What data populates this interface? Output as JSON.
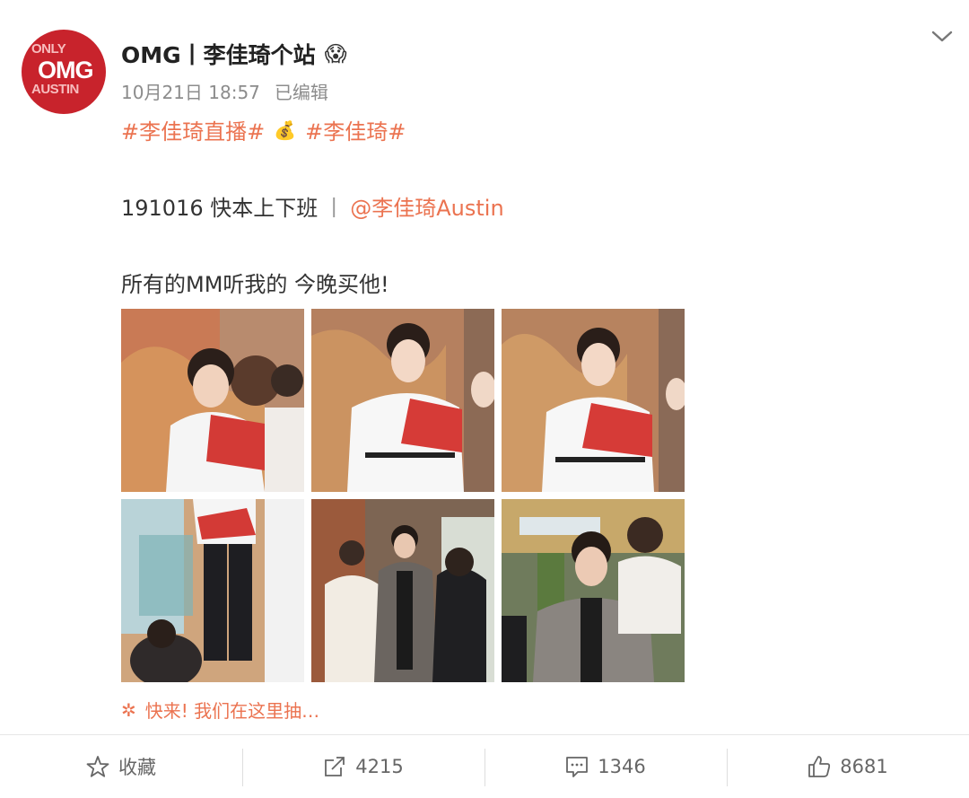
{
  "post": {
    "avatar_text": {
      "top": "ONLY",
      "middle": "OMG",
      "bottom": "AUSTIN"
    },
    "author": "OMG丨李佳琦个站",
    "author_emoji": "😱",
    "time": "10月21日 18:57",
    "edited": "已编辑",
    "tags": [
      "#李佳琦直播#",
      "💰",
      "#李佳琦#"
    ],
    "line1_text": "191016 快本上下班",
    "line1_sep": "丨",
    "mention": "@李佳琦Austin",
    "line2_text": "所有的MM听我的 今晚买他!",
    "photos": [
      {
        "alt": "photo-1"
      },
      {
        "alt": "photo-2"
      },
      {
        "alt": "photo-3"
      },
      {
        "alt": "photo-4"
      },
      {
        "alt": "photo-5"
      },
      {
        "alt": "photo-6"
      }
    ],
    "lottery_icon": "✲",
    "lottery_text": "快来! 我们在这里抽…"
  },
  "actions": {
    "favorite": {
      "icon": "star-icon",
      "label": "收藏"
    },
    "repost": {
      "icon": "share-icon",
      "label": "4215"
    },
    "comment": {
      "icon": "comment-icon",
      "label": "1346"
    },
    "like": {
      "icon": "thumbs-up-icon",
      "label": "8681"
    }
  },
  "colors": {
    "accent": "#eb7350",
    "avatar_red": "#c8232c",
    "text": "#333333",
    "muted": "#8c8c8c"
  }
}
